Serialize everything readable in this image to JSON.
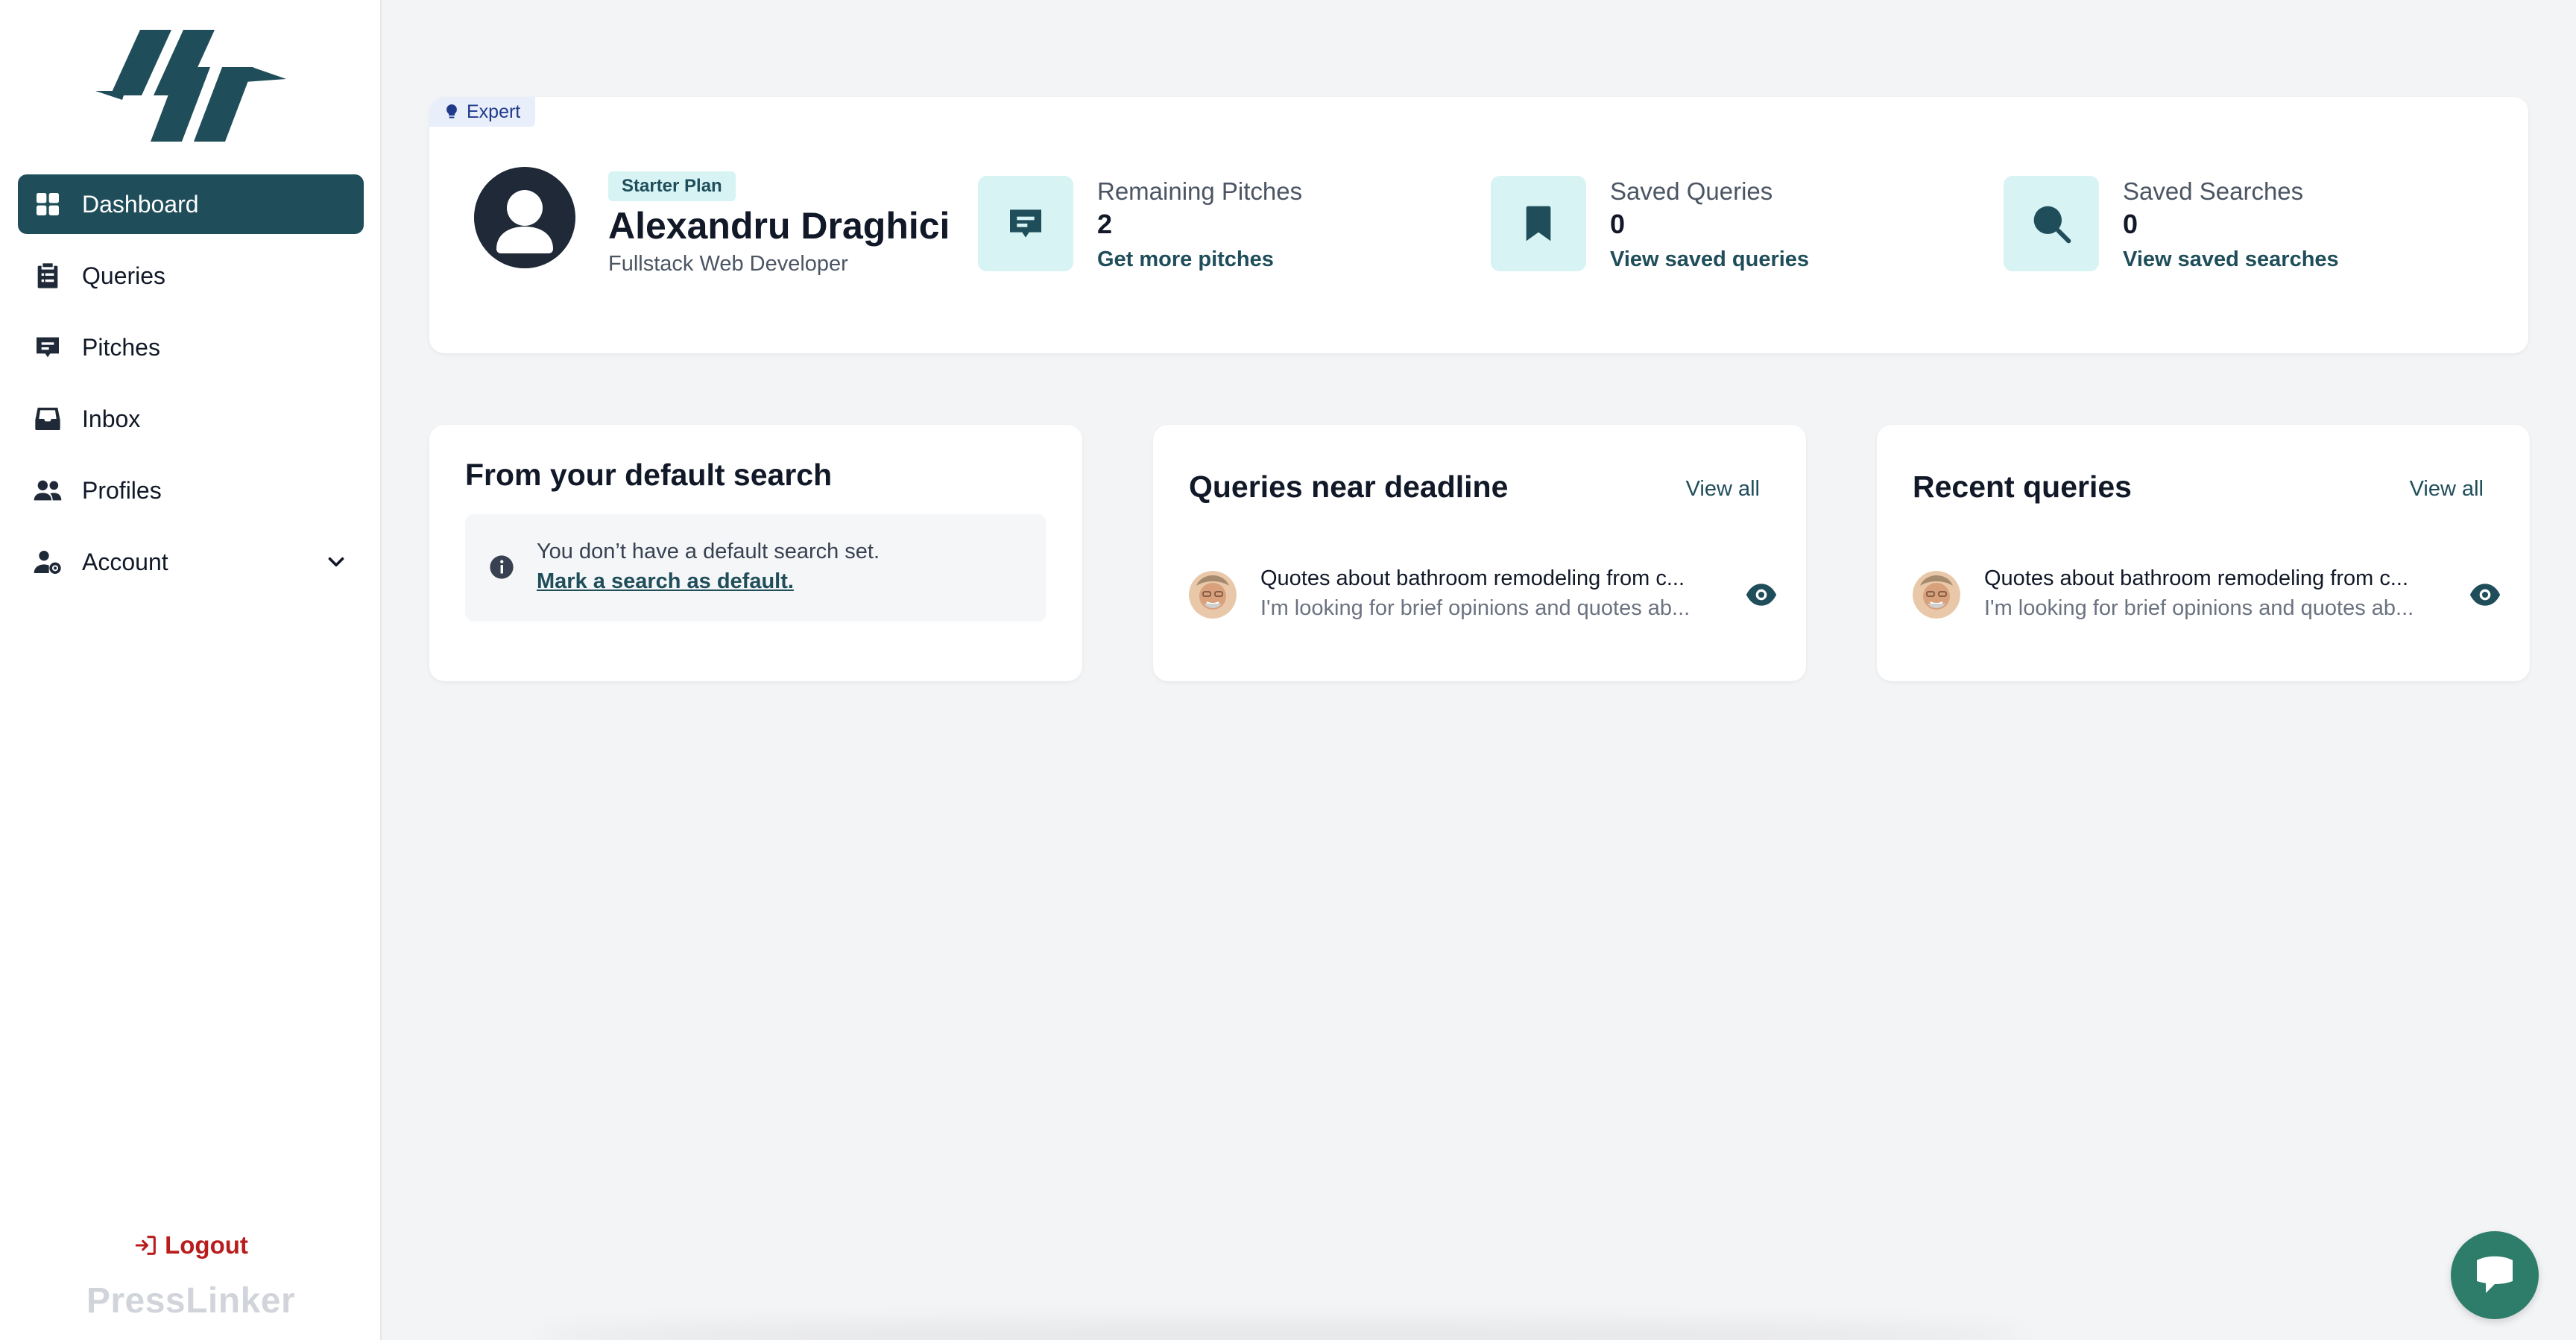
{
  "sidebar": {
    "logo_icon": "presslinker-logo-icon",
    "items": [
      {
        "label": "Dashboard",
        "icon": "dashboard-icon",
        "active": true
      },
      {
        "label": "Queries",
        "icon": "clipboard-icon"
      },
      {
        "label": "Pitches",
        "icon": "message-icon"
      },
      {
        "label": "Inbox",
        "icon": "inbox-icon"
      },
      {
        "label": "Profiles",
        "icon": "users-icon"
      },
      {
        "label": "Account",
        "icon": "user-gear-icon",
        "expandable": true
      }
    ],
    "logout_label": "Logout",
    "brand": "PressLinker"
  },
  "profile": {
    "badge": "Expert",
    "plan": "Starter Plan",
    "name": "Alexandru Draghici",
    "role": "Fullstack Web Developer"
  },
  "stats": [
    {
      "title": "Remaining Pitches",
      "value": "2",
      "link": "Get more pitches",
      "icon": "message-icon"
    },
    {
      "title": "Saved Queries",
      "value": "0",
      "link": "View saved queries",
      "icon": "bookmark-icon"
    },
    {
      "title": "Saved Searches",
      "value": "0",
      "link": "View saved searches",
      "icon": "search-icon"
    }
  ],
  "default_search": {
    "title": "From your default search",
    "empty_text": "You don’t have a default search set.",
    "link": "Mark a search as default."
  },
  "near_deadline": {
    "title": "Queries near deadline",
    "view_all": "View all",
    "items": [
      {
        "title": "Quotes about bathroom remodeling from c...",
        "desc": "I'm looking for brief opinions and quotes ab..."
      }
    ]
  },
  "recent": {
    "title": "Recent queries",
    "view_all": "View all",
    "items": [
      {
        "title": "Quotes about bathroom remodeling from c...",
        "desc": "I'm looking for brief opinions and quotes ab..."
      }
    ]
  },
  "colors": {
    "primary": "#1f4e5a",
    "accent_bg": "#d7f3f4",
    "logout": "#b91c1c",
    "chat": "#2e7d6a"
  }
}
